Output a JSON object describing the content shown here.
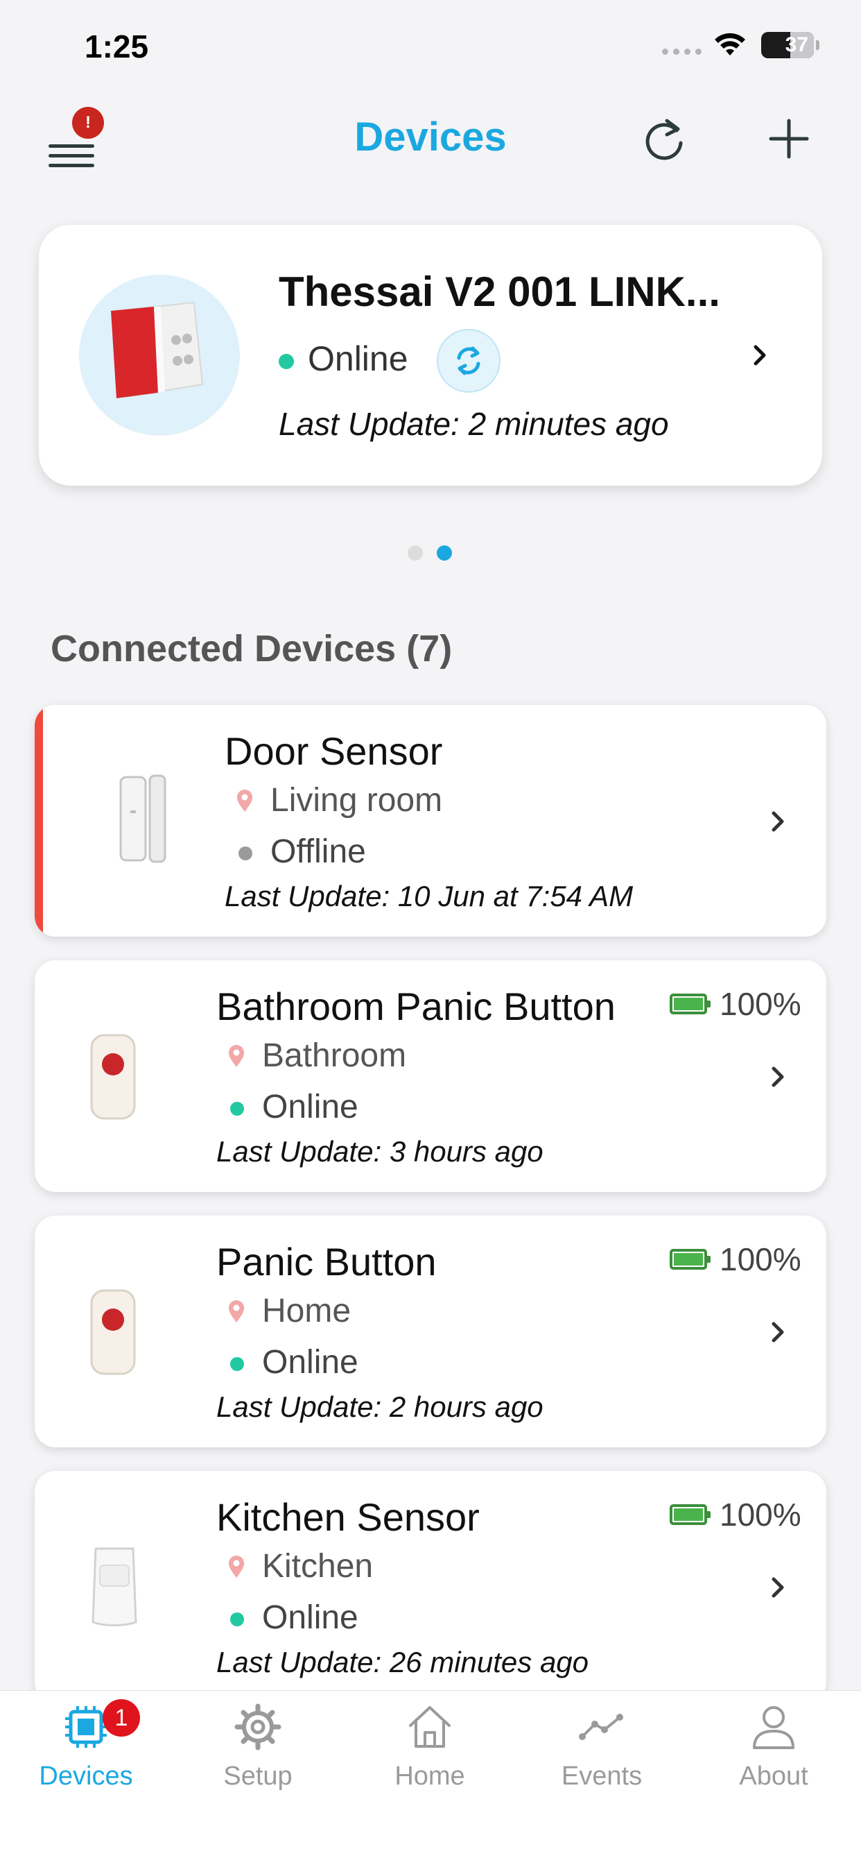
{
  "status_bar": {
    "time": "1:25",
    "battery": "37"
  },
  "header": {
    "title": "Devices",
    "menu_badge": "!"
  },
  "hub": {
    "name": "Thessai V2 001 LINK...",
    "status": "Online",
    "last_update": "Last Update: 2 minutes ago",
    "status_color": "#22c9a0"
  },
  "pager": {
    "pages": 2,
    "active": 2
  },
  "section": {
    "title": "Connected Devices (7)"
  },
  "devices": [
    {
      "name": "Door Sensor",
      "location": "Living room",
      "status": "Offline",
      "last_update": "Last Update: 10 Jun at 7:54 AM",
      "battery": "",
      "alert": true,
      "status_color": "#9a9a9a"
    },
    {
      "name": "Bathroom Panic Button",
      "location": "Bathroom",
      "status": "Online",
      "last_update": "Last Update: 3 hours ago",
      "battery": "100%",
      "alert": false,
      "status_color": "#22c9a0"
    },
    {
      "name": "Panic Button",
      "location": "Home",
      "status": "Online",
      "last_update": "Last Update: 2 hours ago",
      "battery": "100%",
      "alert": false,
      "status_color": "#22c9a0"
    },
    {
      "name": "Kitchen Sensor",
      "location": "Kitchen",
      "status": "Online",
      "last_update": "Last Update: 26 minutes ago",
      "battery": "100%",
      "alert": false,
      "status_color": "#22c9a0"
    }
  ],
  "tabs": [
    {
      "label": "Devices",
      "icon": "chip-icon",
      "badge": "1",
      "active": true
    },
    {
      "label": "Setup",
      "icon": "gear-icon",
      "active": false
    },
    {
      "label": "Home",
      "icon": "home-icon",
      "active": false
    },
    {
      "label": "Events",
      "icon": "activity-graph-icon",
      "active": false
    },
    {
      "label": "About",
      "icon": "user-icon",
      "active": false
    }
  ],
  "colors": {
    "accent": "#1ba8e0",
    "alert": "#ef4a3d",
    "online": "#22c9a0",
    "offline": "#9a9a9a",
    "battery": "#4bb34b"
  }
}
